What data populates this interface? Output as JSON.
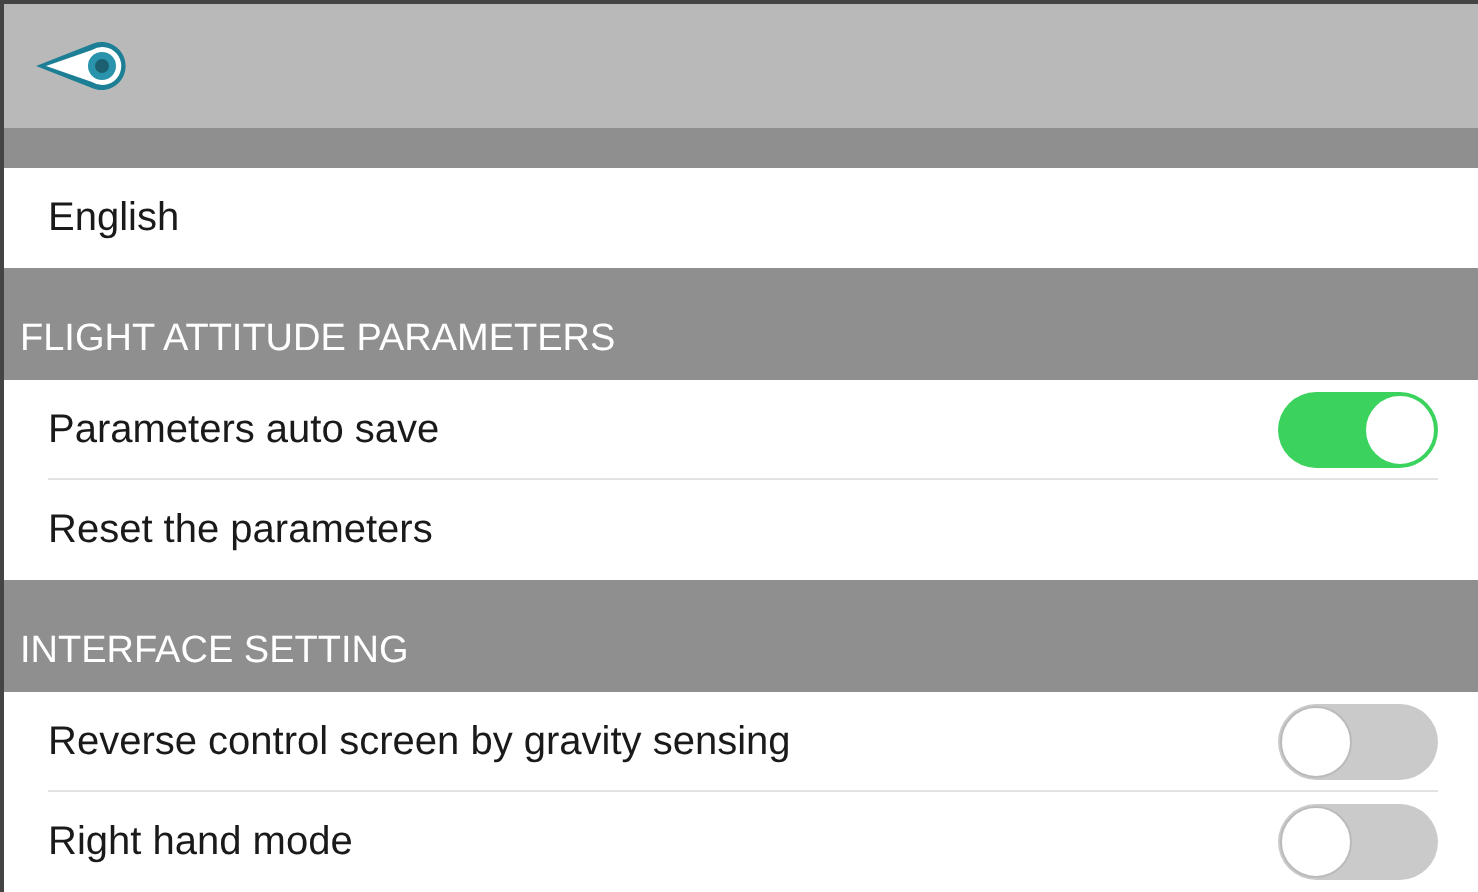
{
  "sections": [
    {
      "rows": [
        {
          "kind": "plain",
          "label": "English"
        }
      ]
    },
    {
      "title": "FLIGHT ATTITUDE PARAMETERS",
      "rows": [
        {
          "kind": "toggle",
          "label": "Parameters auto save",
          "on": true
        },
        {
          "kind": "plain",
          "label": "Reset the parameters"
        }
      ]
    },
    {
      "title": "INTERFACE SETTING",
      "rows": [
        {
          "kind": "toggle",
          "label": "Reverse control screen by gravity sensing",
          "on": false
        },
        {
          "kind": "toggle",
          "label": "Right hand mode",
          "on": false
        }
      ]
    }
  ]
}
